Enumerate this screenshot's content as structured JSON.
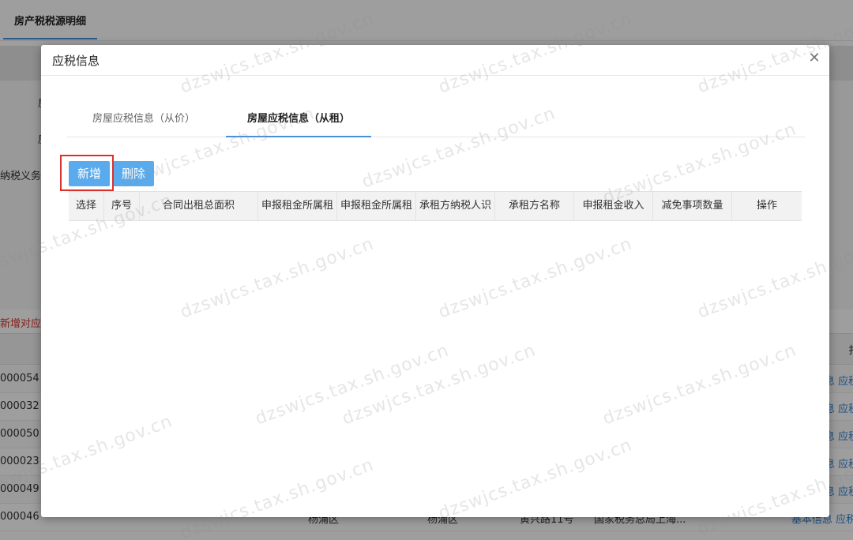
{
  "background": {
    "tab_label": "房产税税源明细",
    "form_labels": [
      "房",
      "房",
      "纳税义务"
    ],
    "red_notice": "新增对应",
    "header_right": "扌",
    "rows": [
      {
        "id": "000054",
        "links": "息 应税"
      },
      {
        "id": "000032",
        "links": "息 应税"
      },
      {
        "id": "000050",
        "links": "息 应税"
      },
      {
        "id": "000023",
        "links": "息 应税"
      },
      {
        "id": "000049",
        "links": "息 应税"
      },
      {
        "id": "000046",
        "district_1": "杨浦区",
        "district_2": "杨浦区",
        "address": "黄兴路11号",
        "owner": "国家税务总局上海...",
        "links": "基本信息 应税"
      }
    ]
  },
  "dialog": {
    "title": "应税信息",
    "close_icon": "close-icon",
    "tabs": [
      {
        "label": "房屋应税信息（从价）",
        "active": false
      },
      {
        "label": "房屋应税信息（从租）",
        "active": true
      }
    ],
    "buttons": {
      "add": "新增",
      "delete": "删除"
    },
    "table": {
      "columns": [
        "选择",
        "序号",
        "合同出租总面积",
        "申报租金所属租",
        "申报租金所属租",
        "承租方纳税人识",
        "承租方名称",
        "申报租金收入",
        "减免事项数量",
        "操作"
      ],
      "rows": []
    }
  },
  "watermark": "dzswjcs.tax.sh.gov.cn",
  "colors": {
    "accent": "#4a90d9",
    "button": "#5aabee",
    "highlight": "#d9322b",
    "link": "#2f80d6"
  }
}
